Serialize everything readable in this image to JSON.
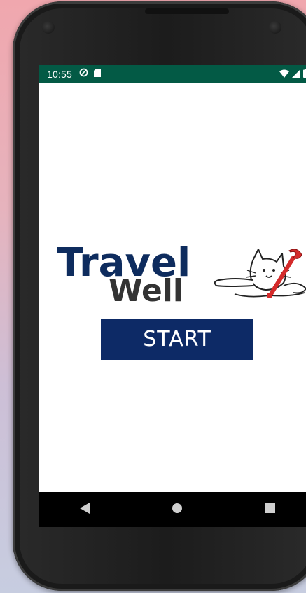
{
  "status_bar": {
    "time": "10:55",
    "left_icons": [
      "sync-icon",
      "sd-card-icon"
    ],
    "right_icons": [
      "wifi-icon",
      "signal-icon",
      "battery-icon"
    ],
    "background": "#035a45"
  },
  "app": {
    "logo": {
      "title_line1": "Travel",
      "title_line2": "Well",
      "title_color": "#0e2c5e",
      "subtitle_color": "#333333"
    },
    "start_button": {
      "label": "START",
      "background": "#0d2a66"
    }
  },
  "nav_bar": {
    "buttons": [
      "back-icon",
      "home-icon",
      "recents-icon"
    ]
  }
}
